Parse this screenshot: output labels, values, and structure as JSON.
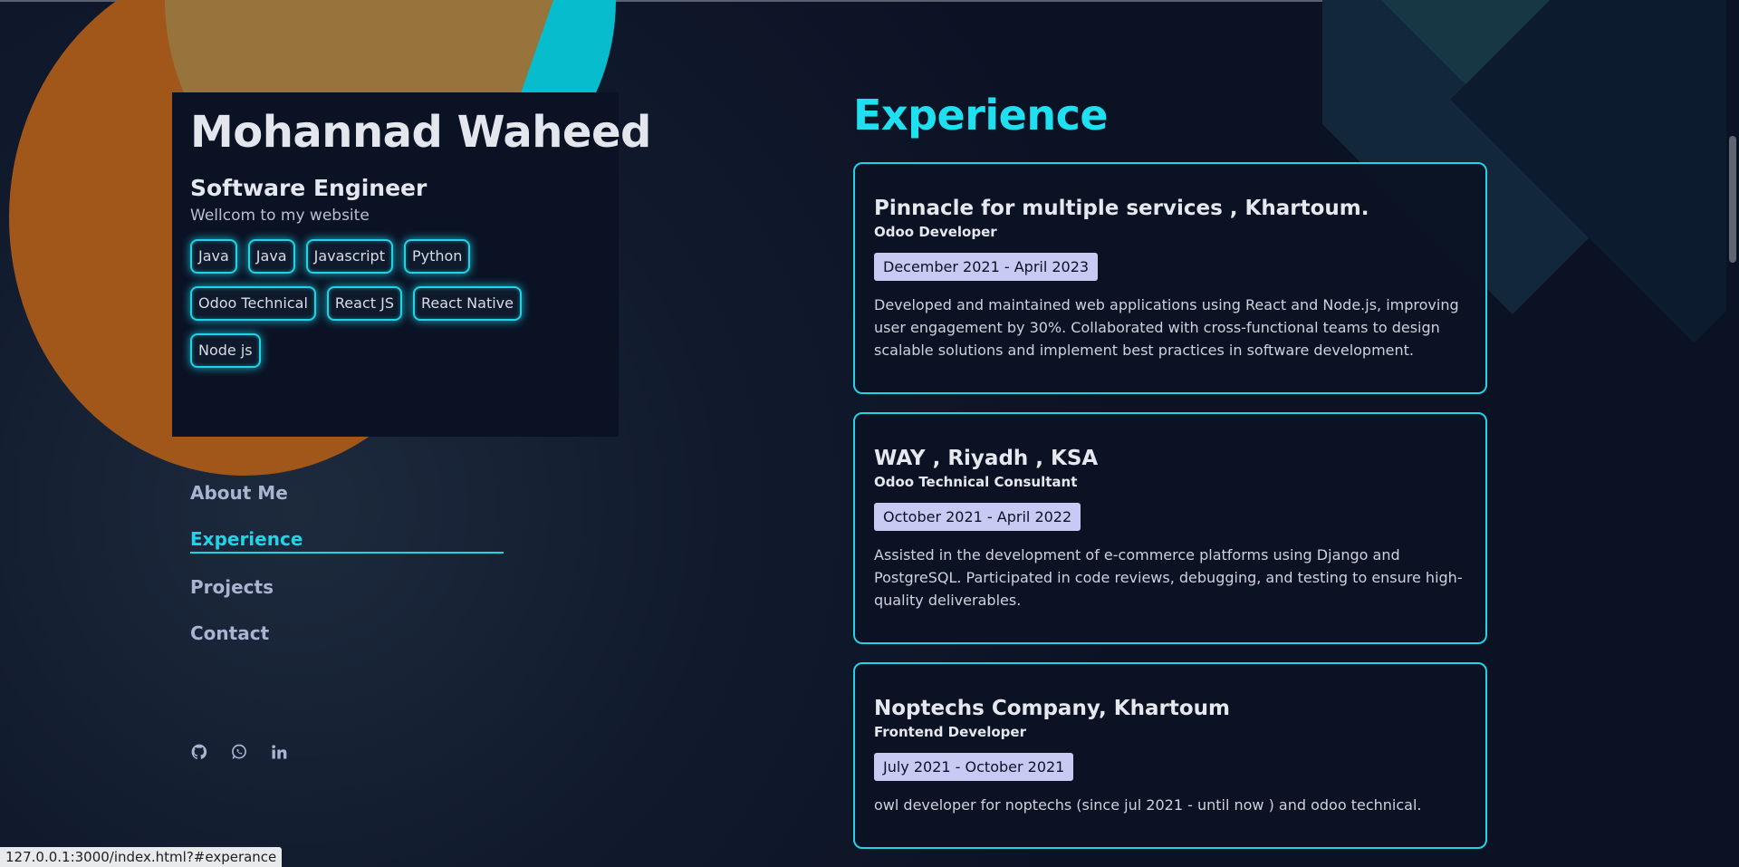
{
  "profile": {
    "name": "Mohannad Waheed",
    "role": "Software Engineer",
    "welcome": "Wellcom to my website",
    "skills": [
      "Java",
      "Java",
      "Javascript",
      "Python",
      "Odoo Technical",
      "React JS",
      "React Native",
      "Node js"
    ]
  },
  "nav": {
    "items": [
      {
        "label": "About Me",
        "active": false
      },
      {
        "label": "Experience",
        "active": true
      },
      {
        "label": "Projects",
        "active": false
      },
      {
        "label": "Contact",
        "active": false
      }
    ]
  },
  "social": {
    "icons": [
      "github-icon",
      "whatsapp-icon",
      "linkedin-icon"
    ]
  },
  "experience": {
    "title": "Experience",
    "items": [
      {
        "company": "Pinnacle for multiple services , Khartoum.",
        "role": "Odoo Developer",
        "date": "December 2021 - April 2023",
        "description": "Developed and maintained web applications using React and Node.js, improving user engagement by 30%. Collaborated with cross-functional teams to design scalable solutions and implement best practices in software development."
      },
      {
        "company": "WAY , Riyadh , KSA",
        "role": "Odoo Technical Consultant",
        "date": "October 2021 - April 2022",
        "description": "Assisted in the development of e-commerce platforms using Django and PostgreSQL. Participated in code reviews, debugging, and testing to ensure high-quality deliverables."
      },
      {
        "company": "Noptechs Company, Khartoum",
        "role": "Frontend Developer",
        "date": "July 2021 - October 2021",
        "description": "owl developer for noptechs (since jul 2021 - until now ) and odoo technical."
      }
    ]
  },
  "status_url": "127.0.0.1:3000/index.html?#experance",
  "colors": {
    "accent": "#22d3e6",
    "background": "#0b1224",
    "date_badge": "#c7cbf4",
    "orange_shape": "#a1561a"
  }
}
